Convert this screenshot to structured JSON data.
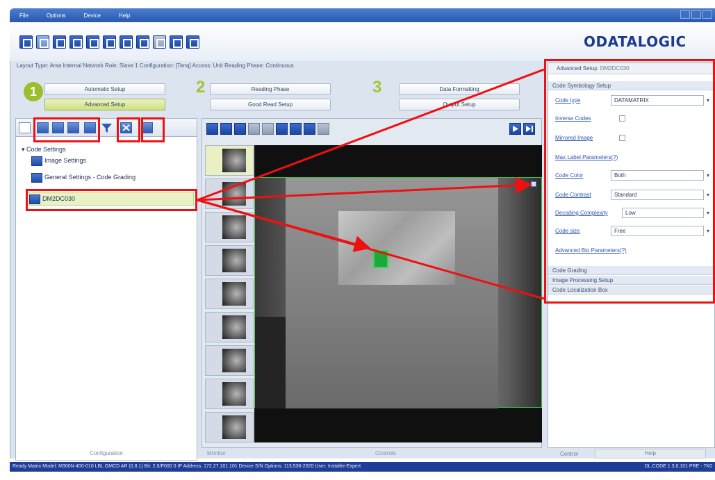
{
  "menu": {
    "file": "File",
    "options": "Options",
    "device": "Device",
    "help": "Help"
  },
  "brand": {
    "logo_text": "ODATALOGIC"
  },
  "layout_bar": "Layout Type: Area  Internal Network Role: Slave 1  Configuration: [Tenq]  Access: Unit  Reading Phase: Continuous",
  "steps": {
    "step1_num": "1",
    "step2_num": "2",
    "step3_num": "3",
    "automatic_setup": "Automatic Setup",
    "advanced_setup": "Advanced Setup",
    "reading_phase": "Reading Phase",
    "good_read_setup": "Good Read Setup",
    "data_formatting": "Data Formatting",
    "output_setup": "Output Setup"
  },
  "tree": {
    "code_settings": "Code Settings",
    "image_settings": "Image Settings",
    "general_settings": "General Settings - Code Grading",
    "selected_code": "DM2DC030"
  },
  "left_footer": "Configuration",
  "thumbnails": [
    "",
    "",
    "",
    "",
    "",
    "",
    "",
    "",
    "",
    ""
  ],
  "center_footer": {
    "left": "Monitor",
    "center": "Controls"
  },
  "right_panel": {
    "header_label": "Advanced Setup",
    "header_value": "DM2DC030",
    "section_code_symbology": "Code Symbology Setup",
    "code_type_label": "Code type",
    "code_type_value": "DATAMATRIX",
    "inverse_codes_label": "Inverse Codes",
    "mirrored_label": "Mirrored Image",
    "max_label_len_label": "Max Label Parameters(?)",
    "code_color_label": "Code Color",
    "code_color_value": "Both",
    "code_contrast_label": "Code Contrast",
    "code_contrast_value": "Standard",
    "decoding_complexity_label": "Decoding Complexity",
    "decoding_complexity_value": "Low",
    "code_size_label": "Code size",
    "code_size_value": "Free",
    "advanced_params_label": "Advanced Bio Parameters(?)",
    "section_code_grading": "Code Grading",
    "section_image_processing": "Image Processing Setup",
    "section_code_localization": "Code Localization Box"
  },
  "right_footer": {
    "control": "Control",
    "help": "Help"
  },
  "statusbar": {
    "left": "Ready  Matrix  Model: M300N-400-010 LBL GMCD AR (0.8.1)  Bit: 2.0/P000 0  IP Address: 172.27.101.101  Device S/N Options: 113.536-2020  User: Installer-Expert",
    "right": "DL.CODE 1.3.0.101 PRE - 7K0"
  },
  "colors": {
    "accent_blue": "#1f3c96",
    "highlight_red": "#e11111",
    "step_green": "#9bbf2c",
    "code_green": "#1da83d"
  }
}
